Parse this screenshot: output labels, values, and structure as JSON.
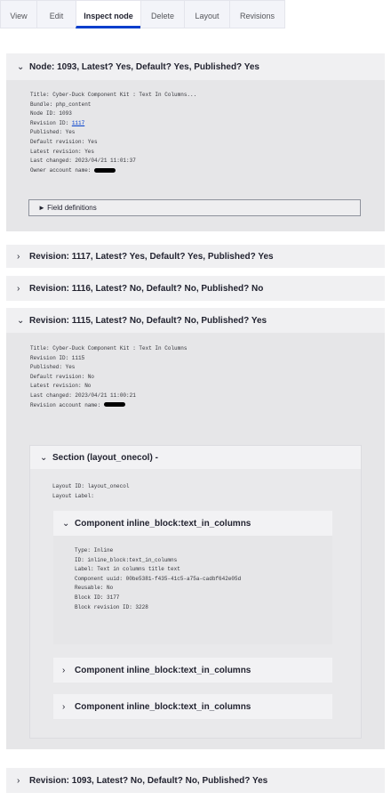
{
  "tabs": [
    {
      "label": "View",
      "active": false
    },
    {
      "label": "Edit",
      "active": false
    },
    {
      "label": "Inspect node",
      "active": true
    },
    {
      "label": "Delete",
      "active": false
    },
    {
      "label": "Layout",
      "active": false
    },
    {
      "label": "Revisions",
      "active": false
    }
  ],
  "node_panel": {
    "title": "Node: 1093, Latest? Yes, Default? Yes, Published? Yes",
    "title_line": "Title: Cyber-Duck Component Kit : Text In Columns...",
    "bundle": "Bundle: php_content",
    "node_id": "Node ID: 1093",
    "revision_id_label": "Revision ID: ",
    "revision_id_link": "1117",
    "published": "Published: Yes",
    "default_revision": "Default revision: Yes",
    "latest_revision": "Latest revision: Yes",
    "last_changed": "Last changed: 2023/04/21 11:01:37",
    "owner": "Owner account name: ",
    "field_definitions": "► Field definitions"
  },
  "revision_1117": {
    "title": "Revision: 1117, Latest? Yes, Default? Yes, Published? Yes"
  },
  "revision_1116": {
    "title": "Revision: 1116, Latest? No, Default? No, Published? No"
  },
  "revision_1115": {
    "title": "Revision: 1115, Latest? No, Default? No, Published? Yes",
    "title_line": "Title: Cyber-Duck Component Kit : Text In Columns",
    "revision_id": "Revision ID: 1115",
    "published": "Published: Yes",
    "default_revision": "Default revision: No",
    "latest_revision": "Latest revision: No",
    "last_changed": "Last changed: 2023/04/21 11:00:21",
    "revision_account": "Revision account name: ",
    "section": {
      "title": "Section (layout_onecol) -",
      "layout_id": "Layout ID: layout_onecol",
      "layout_label": "Layout Label:",
      "component_open": {
        "title": "Component inline_block:text_in_columns",
        "type": "Type: Inline",
        "id": "ID: inline_block:text_in_columns",
        "label": "Label: Text in columns title text",
        "uuid": "Component uuid: 00be5381-f435-41c5-a75a-cadbf642e05d",
        "reusable": "Reusable: No",
        "block_id": "Block ID: 3177",
        "block_revision_id": "Block revision ID: 3228"
      },
      "component_2": {
        "title": "Component inline_block:text_in_columns"
      },
      "component_3": {
        "title": "Component inline_block:text_in_columns"
      }
    }
  },
  "revision_1093": {
    "title": "Revision: 1093, Latest? No, Default? No, Published? Yes"
  }
}
